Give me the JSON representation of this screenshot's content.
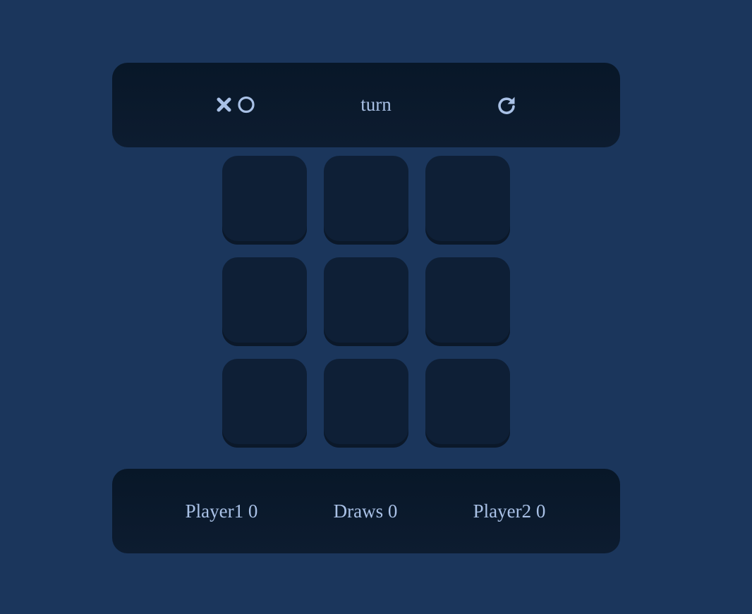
{
  "header": {
    "logo_icon": "x-o-icon",
    "turn_label": "turn",
    "restart_icon": "restart-icon"
  },
  "board": {
    "cells": [
      "",
      "",
      "",
      "",
      "",
      "",
      "",
      "",
      ""
    ]
  },
  "scoreboard": {
    "player1": "Player1 0",
    "draws": "Draws 0",
    "player2": "Player2 0"
  },
  "colors": {
    "background": "#1b365c",
    "panel": "#081728",
    "cell": "#0e1f36",
    "text": "#a9c1e6"
  }
}
